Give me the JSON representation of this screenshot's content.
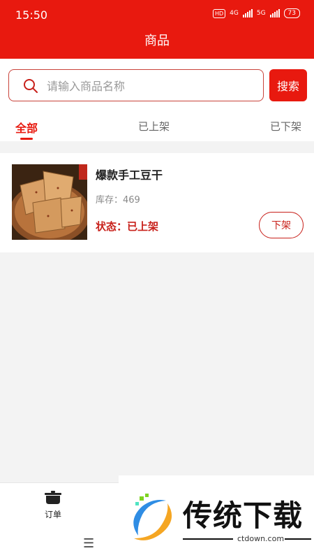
{
  "status_bar": {
    "time": "15:50",
    "hd_badge": "HD",
    "net1": "4G",
    "net2": "5G",
    "battery": "73"
  },
  "header": {
    "title": "商品"
  },
  "search": {
    "placeholder": "请输入商品名称",
    "value": "",
    "button_label": "搜索"
  },
  "tabs": [
    {
      "label": "全部",
      "active": true
    },
    {
      "label": "已上架",
      "active": false
    },
    {
      "label": "已下架",
      "active": false
    }
  ],
  "products": [
    {
      "name": "爆款手工豆干",
      "stock_label": "库存：",
      "stock_value": "469",
      "status": "状态：已上架",
      "action_label": "下架",
      "image_icon": "tofu-product-image"
    }
  ],
  "bottom_nav": {
    "orders_label": "订单",
    "orders_icon": "pot-icon",
    "menu_icon": "hamburger-icon"
  },
  "watermark": {
    "title": "传统下载",
    "site": "ctdown.com"
  },
  "colors": {
    "brand_red": "#e8190f",
    "status_red": "#c8201a",
    "background": "#f3f3f3"
  }
}
